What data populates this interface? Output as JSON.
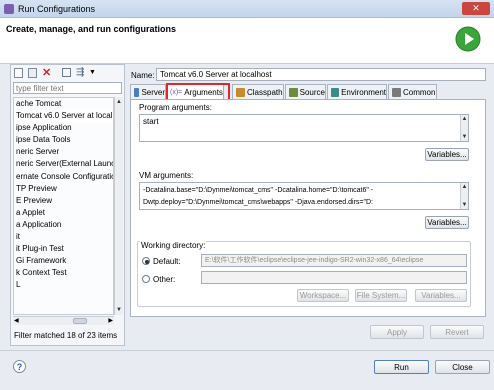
{
  "window": {
    "title": "Run Configurations",
    "close_glyph": "✕"
  },
  "header": {
    "heading": "Create, manage, and run configurations"
  },
  "sidebar": {
    "filter_placeholder": "type filter text",
    "items": [
      "ache Tomcat",
      "Tomcat v6.0 Server at localho",
      "ipse Application",
      "ipse Data Tools",
      "neric Server",
      "neric Server(External Launch)",
      "ernate Console Configuration",
      "TP Preview",
      "E Preview",
      "a Applet",
      "a Application",
      "it",
      "it Plug-in Test",
      "Gi Framework",
      "k Context Test",
      "L"
    ],
    "selected_index": 1,
    "filter_status": "Filter matched 18 of 23 items"
  },
  "config": {
    "name_label": "Name:",
    "name_value": "Tomcat v6.0 Server at localhost",
    "tabs": [
      {
        "label": "Server",
        "icon": "server-icon",
        "color": "#4a7cc2"
      },
      {
        "label": "Arguments",
        "icon": "arguments-icon",
        "color": "#6b5ba8"
      },
      {
        "label": "Classpath",
        "icon": "classpath-icon",
        "color": "#c98a2a"
      },
      {
        "label": "Source",
        "icon": "source-icon",
        "color": "#6f8a3a"
      },
      {
        "label": "Environment",
        "icon": "environment-icon",
        "color": "#3a8a8a"
      },
      {
        "label": "Common",
        "icon": "common-icon",
        "color": "#7a7a7a"
      }
    ],
    "active_tab": "Arguments",
    "program_arguments_label": "Program arguments:",
    "program_arguments_value": "start",
    "variables_label": "Variables...",
    "vm_arguments_label": "VM arguments:",
    "vm_arguments_lines": [
      "-Dcatalina.base=\"D:\\Dynmei\\tomcat_cms\" -Dcatalina.home=\"D:\\tomcat6\" -",
      "Dwtp.deploy=\"D:\\Dynmei\\tomcat_cms\\webapps\" -Djava.endorsed.dirs=\"D:"
    ],
    "working_directory_label": "Working directory:",
    "default_label": "Default:",
    "default_value": "E:\\软件\\工作软件\\eclipse\\eclipse-jee-indigo-SR2-win32-x86_64\\eclipse",
    "other_label": "Other:",
    "workspace_label": "Workspace...",
    "filesystem_label": "File System...",
    "variables2_label": "Variables...",
    "apply_label": "Apply",
    "revert_label": "Revert"
  },
  "footer": {
    "help_glyph": "?",
    "run_label": "Run",
    "close_label": "Close"
  },
  "colors": {
    "highlight_box": "#e0282a",
    "run_green": "#3aa63a"
  }
}
